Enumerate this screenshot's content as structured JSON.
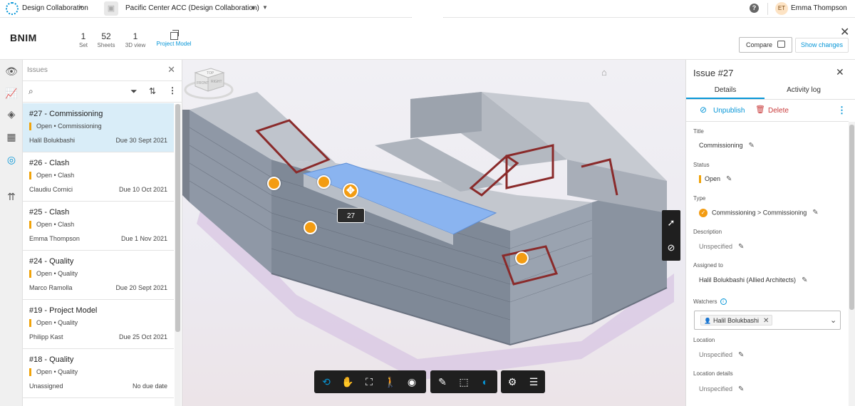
{
  "topbar": {
    "app_name": "Design Collaboration",
    "project_name": "Pacific Center ACC (Design Collaboration)",
    "user_initials": "ET",
    "user_name": "Emma Thompson",
    "more": "···"
  },
  "document": {
    "title": "BNIM",
    "stats": [
      {
        "num": "1",
        "label": "Set"
      },
      {
        "num": "52",
        "label": "Sheets"
      },
      {
        "num": "1",
        "label": "3D view"
      },
      {
        "label": "Project Model"
      }
    ],
    "compare_label": "Compare",
    "show_changes_label": "Show changes"
  },
  "issues_panel": {
    "title": "Issues",
    "items": [
      {
        "title": "#27 - Commissioning",
        "status": "Open • Commissioning",
        "assignee": "Halil Bolukbashi",
        "due": "Due 30 Sept 2021",
        "selected": true
      },
      {
        "title": "#26 - Clash",
        "status": "Open • Clash",
        "assignee": "Claudiu Cornici",
        "due": "Due 10 Oct 2021"
      },
      {
        "title": "#25 - Clash",
        "status": "Open • Clash",
        "assignee": "Emma Thompson",
        "due": "Due 1 Nov 2021"
      },
      {
        "title": "#24 - Quality",
        "status": "Open • Quality",
        "assignee": "Marco Ramolla",
        "due": "Due 20 Sept 2021"
      },
      {
        "title": "#19 - Project Model",
        "status": "Open • Quality",
        "assignee": "Philipp Kast",
        "due": "Due 25 Oct 2021"
      },
      {
        "title": "#18 - Quality",
        "status": "Open • Quality",
        "assignee": "Unassigned",
        "due": "No due date"
      }
    ]
  },
  "viewer": {
    "pin_label": "27",
    "status_color": "#f39c12",
    "accent_color": "#0696d7",
    "viewcube": {
      "top": "TOP",
      "front": "FRONT",
      "right": "RIGHT"
    }
  },
  "detail_panel": {
    "title": "Issue #27",
    "tabs": [
      "Details",
      "Activity log"
    ],
    "unpublish_label": "Unpublish",
    "delete_label": "Delete",
    "fields": {
      "title_label": "Title",
      "title_value": "Commissioning",
      "status_label": "Status",
      "status_value": "Open",
      "type_label": "Type",
      "type_value": "Commissioning > Commissioning",
      "description_label": "Description",
      "description_value": "Unspecified",
      "assigned_label": "Assigned to",
      "assigned_value": "Halil Bolukbashi (Allied Architects)",
      "watchers_label": "Watchers",
      "watcher_chip": "Halil Bolukbashi",
      "location_label": "Location",
      "location_value": "Unspecified",
      "location_details_label": "Location details",
      "location_details_value": "Unspecified"
    }
  }
}
